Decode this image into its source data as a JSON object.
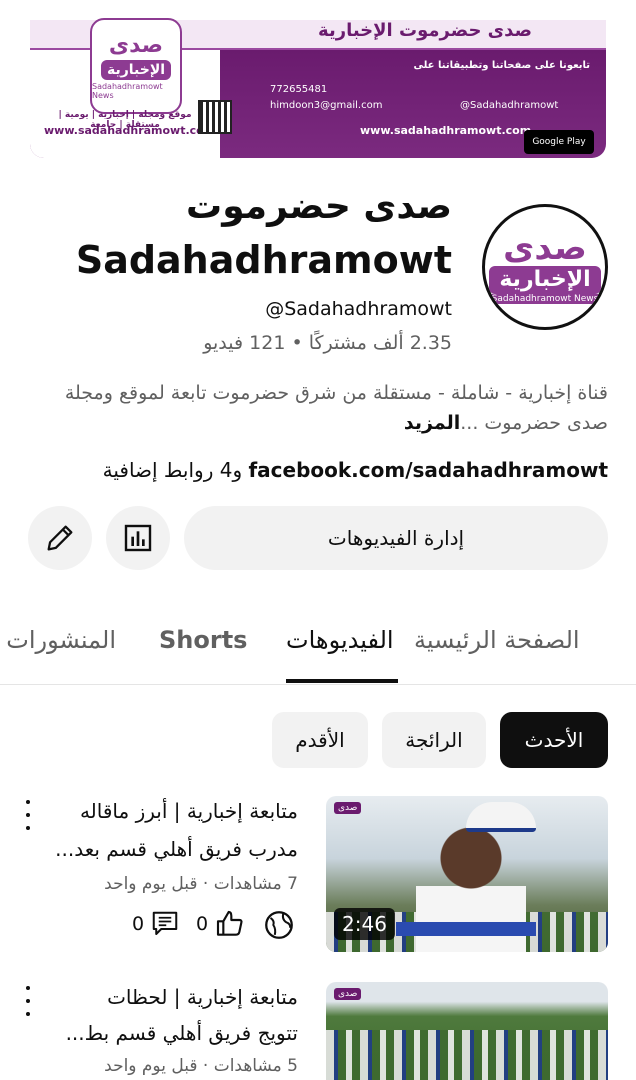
{
  "banner": {
    "logo_title": "صدى",
    "logo_sub": "الإخبارية",
    "logo_en": "Sadahadhramowt News",
    "headline": "صدى حضرموت الإخبارية",
    "follow_text": "تابعونا على صفحاتنا وتطبيقاتنا على",
    "phone": "772655481",
    "email": "himdoon3@gmail.com",
    "handle": "@Sadahadhramowt",
    "url_right": "www.sadahadhramowt.com",
    "url_left": "www.sadahadhramowt.com",
    "left_tagline": "موقع ومجلة | إخبارية | يومية | مستقلة | جامعة",
    "store_label": "Google Play"
  },
  "channel": {
    "name_ar": "صدى حضرموت",
    "name_en": "Sadahadhramowt",
    "handle": "@Sadahadhramowt",
    "stats": "2.35 ألف مشتركًا • 121 فيديو",
    "description": "قناة إخبارية - شاملة - مستقلة من شرق حضرموت تابعة لموقع ومجلة صدى حضرموت ...",
    "more_label": "المزيد",
    "link_site": "facebook.com/sadahadhramowt",
    "link_extra": " و4 روابط إضافية",
    "avatar_title": "صدى",
    "avatar_sub": "الإخبارية",
    "avatar_en": "Sadahadhramowt News"
  },
  "actions": {
    "manage_label": "إدارة الفيديوهات"
  },
  "tabs": [
    {
      "label": "الصفحة الرئيسية"
    },
    {
      "label": "الفيديوهات"
    },
    {
      "label": "Shorts"
    },
    {
      "label": "المنشورات"
    }
  ],
  "filters": [
    {
      "label": "الأحدث",
      "selected": true
    },
    {
      "label": "الرائجة",
      "selected": false
    },
    {
      "label": "الأقدم",
      "selected": false
    }
  ],
  "videos": [
    {
      "title_line1": "متابعة إخبارية | أبرز ماقاله",
      "title_line2": "مدرب فريق أهلي قسم بعد...",
      "meta": "7 مشاهدات · قبل يوم واحد",
      "likes": "0",
      "comments": "0",
      "duration": "2:46"
    },
    {
      "title_line1": "متابعة إخبارية | لحظات",
      "title_line2": "تتويج فريق أهلي قسم بط...",
      "meta": "5 مشاهدات · قبل يوم واحد"
    }
  ]
}
